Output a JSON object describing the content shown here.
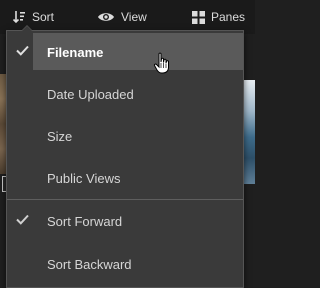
{
  "toolbar": {
    "sort_label": "Sort",
    "view_label": "View",
    "panes_label": "Panes"
  },
  "menu": {
    "sort_by": [
      {
        "label": "Filename",
        "checked": true,
        "highlighted": true
      },
      {
        "label": "Date Uploaded",
        "checked": false
      },
      {
        "label": "Size",
        "checked": false
      },
      {
        "label": "Public Views",
        "checked": false
      }
    ],
    "direction": [
      {
        "label": "Sort Forward",
        "checked": true
      },
      {
        "label": "Sort Backward",
        "checked": false
      }
    ]
  },
  "colors": {
    "menu_bg": "#3a3a3a",
    "highlight_bg": "#5a5a5a",
    "toolbar_bg": "#1a1a1a"
  }
}
